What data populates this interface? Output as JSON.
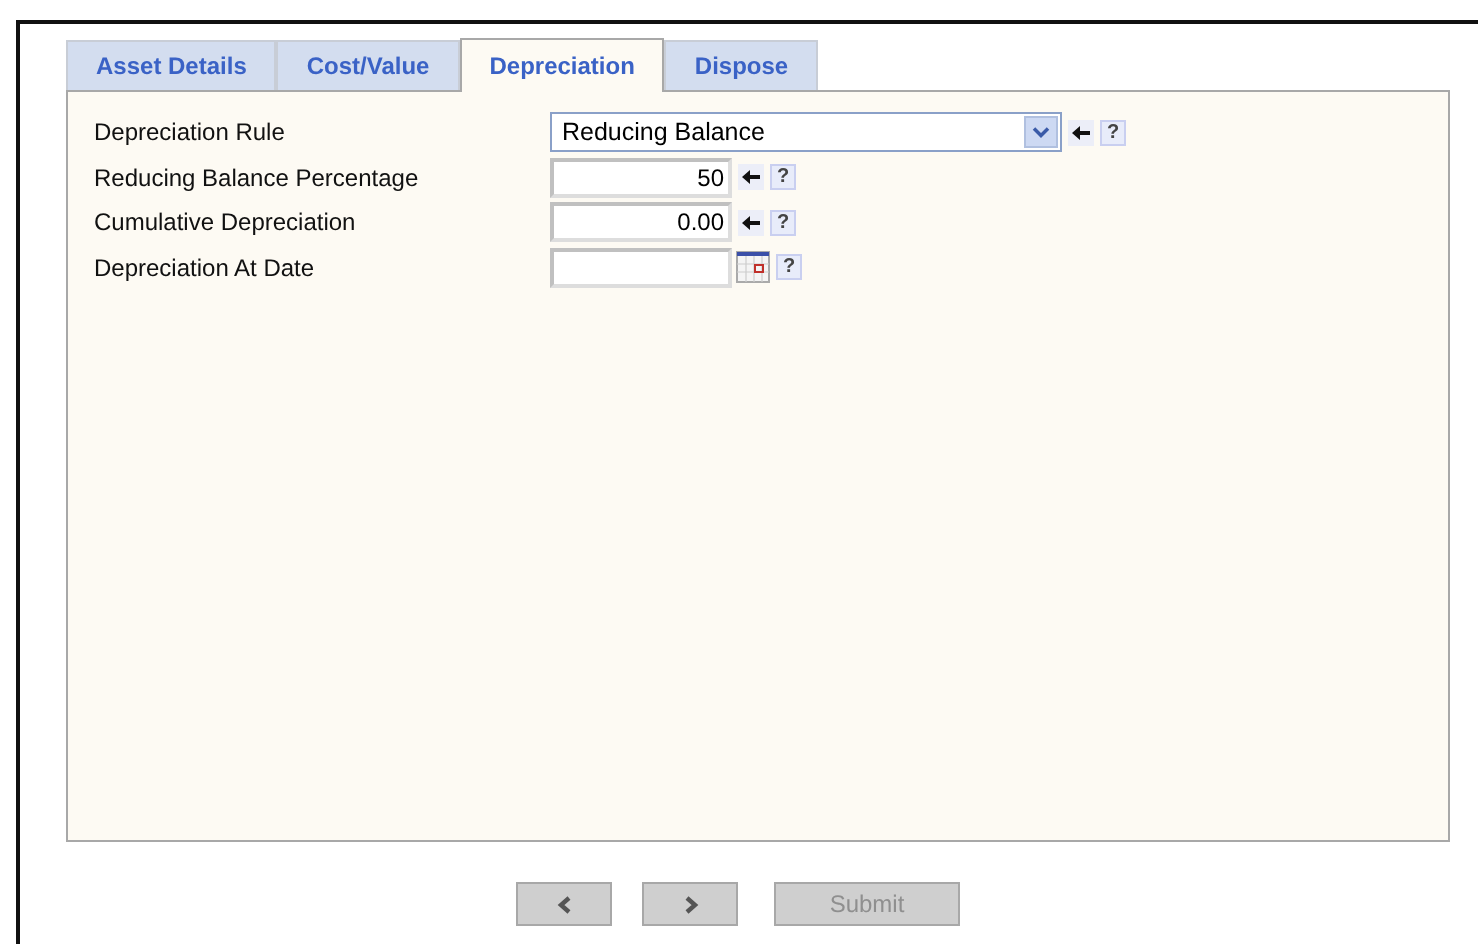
{
  "tabs": [
    {
      "label": "Asset Details",
      "selected": false
    },
    {
      "label": "Cost/Value",
      "selected": false
    },
    {
      "label": "Depreciation",
      "selected": true
    },
    {
      "label": "Dispose",
      "selected": false
    }
  ],
  "fields": [
    {
      "kind": "select",
      "label": "Depreciation Rule",
      "value": "Reducing Balance",
      "help": "?"
    },
    {
      "kind": "number",
      "label": "Reducing Balance Percentage",
      "value": "50",
      "help": "?"
    },
    {
      "kind": "number",
      "label": "Cumulative Depreciation",
      "value": "0.00",
      "help": "?"
    },
    {
      "kind": "date",
      "label": "Depreciation At Date",
      "help": "?"
    }
  ],
  "buttons": [
    {
      "kind": "back",
      "disabled": true
    },
    {
      "kind": "forward",
      "disabled": true
    },
    {
      "kind": "submit",
      "label": "Submit",
      "disabled": true
    }
  ]
}
